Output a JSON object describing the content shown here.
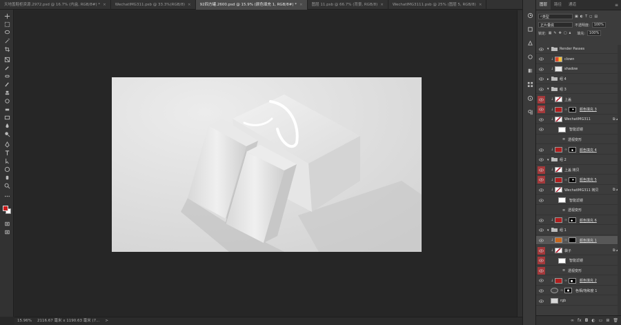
{
  "tabs": [
    {
      "label": "天地盖鞋柜资源.2972.psd @ 16.7% (内盒, RGB/8#) *",
      "active": false
    },
    {
      "label": "WechatIMG311.psb @ 33.3%(RGB/8)",
      "active": false
    },
    {
      "label": "92四方罐.2600.psd @ 15.9% (颜色填充 1, RGB/8#) *",
      "active": true
    },
    {
      "label": "图层 11.psb @ 66.7% (背景, RGB/8)",
      "active": false
    },
    {
      "label": "WechatIMG3111.psb @ 25% (图层 5, RGB/8)",
      "active": false
    }
  ],
  "tab_close": "×",
  "toolbar": {
    "tools": [
      "move-icon",
      "marquee-icon",
      "lasso-icon",
      "magic-wand-icon",
      "crop-icon",
      "frame-icon",
      "eyedropper-icon",
      "healing-icon",
      "brush-icon",
      "stamp-icon",
      "history-brush-icon",
      "eraser-icon",
      "gradient-icon",
      "blur-icon",
      "dodge-icon",
      "pen-icon",
      "type-icon",
      "path-select-icon",
      "shape-icon",
      "hand-icon",
      "zoom-icon",
      "more-icon"
    ],
    "foreground_color": "#cc1a1a",
    "background_color": "#ffffff"
  },
  "status": {
    "zoom": "15.96%",
    "doc_info": "2116.67 毫米 x 1190.63 毫米 (7...",
    "arrow": ">"
  },
  "panel": {
    "tabs": [
      "图层",
      "路径",
      "通道"
    ],
    "active_tab": "图层",
    "filter_label": "类型",
    "blend_mode": "正片叠底",
    "opacity_label": "不透明度:",
    "opacity_value": "100%",
    "lock_label": "锁定:",
    "fill_label": "填充:",
    "fill_value": "100%"
  },
  "layers": [
    {
      "name": "Render Passes",
      "kind": "folder",
      "level": 1,
      "eye": "normal",
      "open": true
    },
    {
      "name": "clown",
      "kind": "layer",
      "level": 2,
      "eye": "normal",
      "thumb": "clown"
    },
    {
      "name": "shadow",
      "kind": "layer",
      "level": 2,
      "eye": "normal",
      "thumb": "shadow"
    },
    {
      "name": "组 4",
      "kind": "folder",
      "level": 1,
      "eye": "normal",
      "open": false
    },
    {
      "name": "组 3",
      "kind": "folder",
      "level": 1,
      "eye": "normal",
      "open": true
    },
    {
      "name": "上盖",
      "kind": "layer",
      "level": 2,
      "eye": "red",
      "thumb": "photo"
    },
    {
      "name": "颜色填充 3",
      "kind": "fill",
      "level": 2,
      "eye": "red",
      "thumb": "red",
      "mask": "mask-a"
    },
    {
      "name": "WechatIMG311",
      "kind": "smart",
      "level": 2,
      "eye": "normal",
      "thumb": "photo"
    },
    {
      "name": "智能滤镜",
      "kind": "filter",
      "level": 3,
      "eye": "normal"
    },
    {
      "name": "透视变形",
      "kind": "sub",
      "level": 4,
      "eye": "none"
    },
    {
      "name": "颜色填充 4",
      "kind": "fill",
      "level": 2,
      "eye": "normal",
      "thumb": "red",
      "mask": "mask-b"
    },
    {
      "name": "组 2",
      "kind": "folder",
      "level": 1,
      "eye": "normal",
      "open": true
    },
    {
      "name": "上盖 拷贝",
      "kind": "layer",
      "level": 2,
      "eye": "red",
      "thumb": "photo"
    },
    {
      "name": "颜色填充 5",
      "kind": "fill",
      "level": 2,
      "eye": "red",
      "thumb": "red",
      "mask": "mask-a"
    },
    {
      "name": "WechatIMG311 拷贝",
      "kind": "smart",
      "level": 2,
      "eye": "normal",
      "thumb": "photo"
    },
    {
      "name": "智能滤镜",
      "kind": "filter",
      "level": 3,
      "eye": "normal"
    },
    {
      "name": "透视变形",
      "kind": "sub",
      "level": 4,
      "eye": "none"
    },
    {
      "name": "颜色填充 6",
      "kind": "fill",
      "level": 2,
      "eye": "normal",
      "thumb": "red",
      "mask": "mask-c"
    },
    {
      "name": "组 1",
      "kind": "folder",
      "level": 1,
      "eye": "normal",
      "open": true
    },
    {
      "name": "颜色填充 1",
      "kind": "fill",
      "level": 2,
      "eye": "normal",
      "thumb": "orange",
      "mask": "black",
      "selected": true
    },
    {
      "name": "袋子",
      "kind": "smart",
      "level": 2,
      "eye": "red",
      "thumb": "photo"
    },
    {
      "name": "智能滤镜",
      "kind": "filter",
      "level": 3,
      "eye": "red"
    },
    {
      "name": "透视变形",
      "kind": "sub",
      "level": 4,
      "eye": "red"
    },
    {
      "name": "颜色填充 2",
      "kind": "fill",
      "level": 2,
      "eye": "normal",
      "thumb": "red",
      "mask": "mask-d"
    },
    {
      "name": "色相/饱和度 1",
      "kind": "adjust",
      "level": 1,
      "eye": "normal",
      "thumb": "adjust",
      "mask": "mask-e"
    },
    {
      "name": "rgb",
      "kind": "layer",
      "level": 1,
      "eye": "normal",
      "thumb": "gray"
    }
  ],
  "panel_bottom_icons": [
    "link-icon",
    "fx-icon",
    "mask-icon",
    "adjustment-icon",
    "group-icon",
    "new-layer-icon",
    "trash-icon"
  ],
  "colors": {
    "red_eye": "#a3393b",
    "selected_row": "#575757"
  }
}
